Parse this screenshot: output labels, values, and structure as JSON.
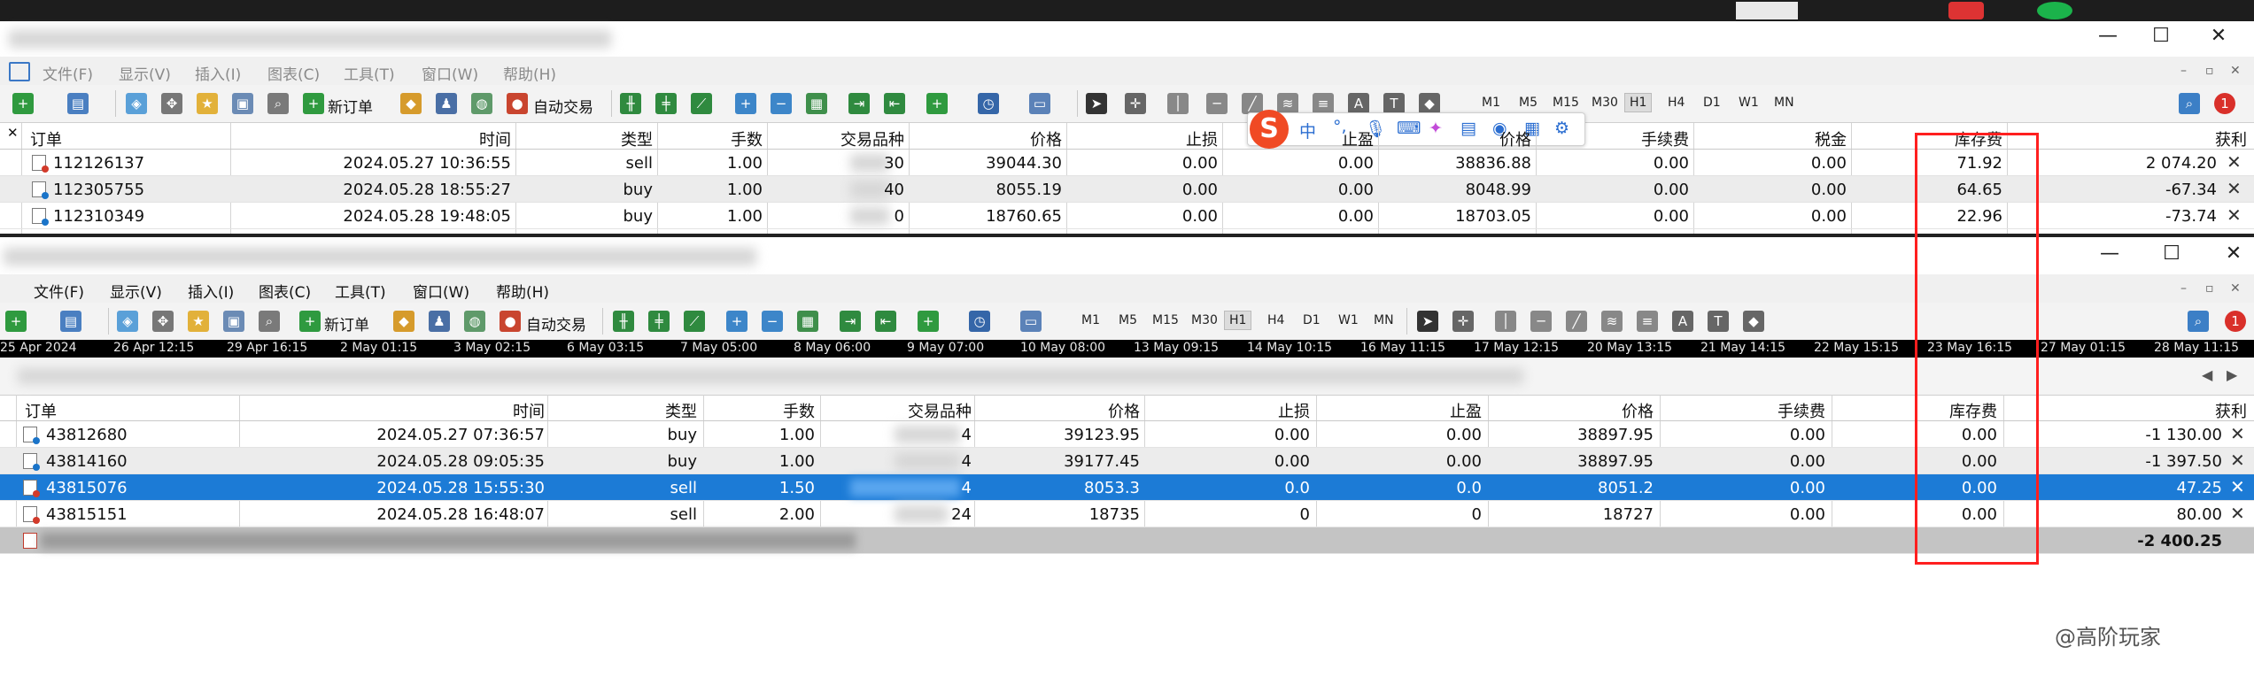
{
  "w1": {
    "menu": [
      "文件(F)",
      "显示(V)",
      "插入(I)",
      "图表(C)",
      "工具(T)",
      "窗口(W)",
      "帮助(H)"
    ],
    "toolbar": {
      "new_order": "新订单",
      "autotrade": "自动交易"
    },
    "timeframes": [
      "M1",
      "M5",
      "M15",
      "M30",
      "H1",
      "H4",
      "D1",
      "W1",
      "MN"
    ],
    "headers": [
      "订单",
      "时间",
      "类型",
      "手数",
      "交易品种",
      "价格",
      "止损",
      "止盈",
      "价格",
      "手续费",
      "税金",
      "库存费",
      "获利"
    ],
    "rows": [
      {
        "order": "112126137",
        "time": "2024.05.27 10:36:55",
        "type": "sell",
        "lots": "1.00",
        "sym_tail": "30",
        "price": "39044.30",
        "sl": "0.00",
        "tp": "0.00",
        "price2": "38836.88",
        "commission": "0.00",
        "tax": "0.00",
        "swap": "71.92",
        "profit": "2 074.20"
      },
      {
        "order": "112305755",
        "time": "2024.05.28 18:55:27",
        "type": "buy",
        "lots": "1.00",
        "sym_tail": "40",
        "price": "8055.19",
        "sl": "0.00",
        "tp": "0.00",
        "price2": "8048.99",
        "commission": "0.00",
        "tax": "0.00",
        "swap": "64.65",
        "profit": "-67.34"
      },
      {
        "order": "112310349",
        "time": "2024.05.28 19:48:05",
        "type": "buy",
        "lots": "1.00",
        "sym_tail": "0",
        "price": "18760.65",
        "sl": "0.00",
        "tp": "0.00",
        "price2": "18703.05",
        "commission": "0.00",
        "tax": "0.00",
        "swap": "22.96",
        "profit": "-73.74"
      }
    ],
    "ime": {
      "mode": "中",
      "punct": "°,"
    }
  },
  "w2": {
    "menu": [
      "文件(F)",
      "显示(V)",
      "插入(I)",
      "图表(C)",
      "工具(T)",
      "窗口(W)",
      "帮助(H)"
    ],
    "toolbar": {
      "new_order": "新订单",
      "autotrade": "自动交易"
    },
    "timeframes": [
      "M1",
      "M5",
      "M15",
      "M30",
      "H1",
      "H4",
      "D1",
      "W1",
      "MN"
    ],
    "time_axis": [
      "25 Apr 2024",
      "26 Apr 12:15",
      "29 Apr 16:15",
      "2 May 01:15",
      "3 May 02:15",
      "6 May 03:15",
      "7 May 05:00",
      "8 May 06:00",
      "9 May 07:00",
      "10 May 08:00",
      "13 May 09:15",
      "14 May 10:15",
      "16 May 11:15",
      "17 May 12:15",
      "20 May 13:15",
      "21 May 14:15",
      "22 May 15:15",
      "23 May 16:15",
      "27 May 01:15",
      "28 May 11:15"
    ],
    "headers": [
      "订单",
      "时间",
      "类型",
      "手数",
      "交易品种",
      "价格",
      "止损",
      "止盈",
      "价格",
      "手续费",
      "库存费",
      "获利"
    ],
    "rows": [
      {
        "order": "43812680",
        "time": "2024.05.27 07:36:57",
        "type": "buy",
        "lots": "1.00",
        "sym_tail": "4",
        "price": "39123.95",
        "sl": "0.00",
        "tp": "0.00",
        "price2": "38897.95",
        "commission": "0.00",
        "swap": "0.00",
        "profit": "-1 130.00"
      },
      {
        "order": "43814160",
        "time": "2024.05.28 09:05:35",
        "type": "buy",
        "lots": "1.00",
        "sym_tail": "4",
        "price": "39177.45",
        "sl": "0.00",
        "tp": "0.00",
        "price2": "38897.95",
        "commission": "0.00",
        "swap": "0.00",
        "profit": "-1 397.50"
      },
      {
        "order": "43815076",
        "time": "2024.05.28 15:55:30",
        "type": "sell",
        "lots": "1.50",
        "sym_tail": "4",
        "price": "8053.3",
        "sl": "0.0",
        "tp": "0.0",
        "price2": "8051.2",
        "commission": "0.00",
        "swap": "0.00",
        "profit": "47.25"
      },
      {
        "order": "43815151",
        "time": "2024.05.28 16:48:07",
        "type": "sell",
        "lots": "2.00",
        "sym_tail": "24",
        "price": "18735",
        "sl": "0",
        "tp": "0",
        "price2": "18727",
        "commission": "0.00",
        "swap": "0.00",
        "profit": "80.00"
      }
    ],
    "total_profit": "-2 400.25"
  },
  "watermark": "@高阶玩家",
  "colors": {
    "selection": "#1c7bd6",
    "annotation": "#ff1f1f"
  }
}
